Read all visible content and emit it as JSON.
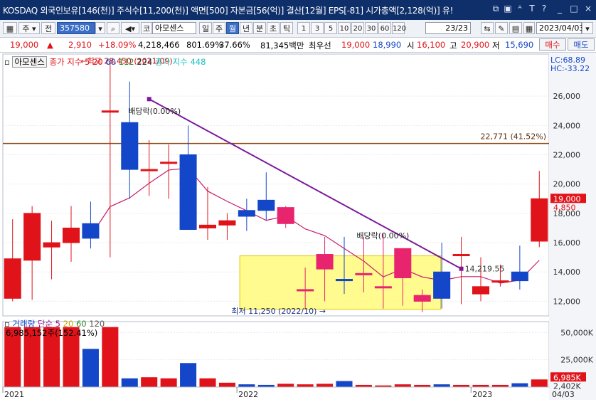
{
  "window": {
    "title": "KOSDAQ 외국인보유[146(천)] 주식수[11,200(천)] 액면[500] 자본금[56(억)] 결산[12월] EPS[-81] 시가총액[2,128(억)] 유!",
    "icons": [
      "restore-icon",
      "window-icon",
      "font-size-icon",
      "text-icon",
      "help-icon",
      "minimize-icon",
      "maximize-icon"
    ]
  },
  "toolbar": {
    "market_label": "주",
    "period_label": "전",
    "code": "357580",
    "stock_prefix": "코",
    "stock_name": "아모센스",
    "periods": [
      "일",
      "주",
      "월",
      "년",
      "분",
      "초",
      "틱"
    ],
    "selected_period": "월",
    "intervals": [
      "1",
      "3",
      "5",
      "10",
      "20",
      "30",
      "60",
      "120"
    ],
    "page": "23/23",
    "date": "2023/04/03"
  },
  "quote": {
    "price": "19,000",
    "change": "2,910",
    "change_pct": "+18.09%",
    "volume": "4,218,466",
    "turnover_pct": "801.69%",
    "ratio": "37.66%",
    "amount": "81,345백만",
    "pref_label": "최우선",
    "ask": "19,000",
    "bid": "18,990",
    "open_label": "시",
    "open": "16,100",
    "high_label": "고",
    "high": "20,900",
    "low_label": "저",
    "low": "15,690",
    "buy_label": "매수",
    "sell_label": "매도"
  },
  "colors": {
    "up": "#e0131a",
    "down": "#1346c8",
    "title_bg": "#0f2f6a",
    "trendline": "#7a1a9a",
    "hline": "#8b4513",
    "box": "#fffa7a"
  },
  "price_panel": {
    "legend_stock": "아모센스",
    "legend_ma": "종가 지수 5",
    "ma_periods": [
      "20",
      "60",
      "112",
      "224"
    ],
    "legend_index": "종가 지수 448",
    "lc": "LC:68.89",
    "hc": "HC:-33.22",
    "price_ticks": [
      "26,000",
      "24,000",
      "22,000",
      "20,000",
      "18,000",
      "16,000",
      "14,000",
      "12,000"
    ],
    "hline_label": "22,771 (41.52%)",
    "max_label": "최고 28,450 (2021/09)",
    "min_label": "최저 11,250 (2022/10)",
    "dividend_label": "배당락(0.00%)",
    "dividend_label_2": "배당락(0.00%)",
    "trend_end_label": "14,219.55",
    "current_price_tag": "19,000",
    "change_tag": "4,850"
  },
  "volume_panel": {
    "legend_vol": "거래량",
    "legend_ma": "단순 5",
    "ma_periods": [
      "20",
      "60",
      "120"
    ],
    "last_volume": "6,985,152주(152.41%)",
    "ticks": [
      "50,000K",
      "25,000K"
    ],
    "current_tag": "6,985K",
    "ma_tag": "2,402K"
  },
  "x_axis": {
    "labels": [
      "2021",
      "2022",
      "2023",
      "04/03"
    ]
  },
  "chart_data": {
    "type": "candlestick",
    "x": [
      "2021/01",
      "2021/02",
      "2021/03",
      "2021/04",
      "2021/05",
      "2021/06",
      "2021/07",
      "2021/08",
      "2021/09",
      "2021/10",
      "2021/11",
      "2021/12",
      "2022/01",
      "2022/02",
      "2022/03",
      "2022/04",
      "2022/05",
      "2022/06",
      "2022/07",
      "2022/08",
      "2022/09",
      "2022/10",
      "2022/11",
      "2022/12",
      "2023/01",
      "2023/02",
      "2023/03",
      "2023/04"
    ],
    "open": [
      12200,
      14800,
      15700,
      16000,
      17300,
      25000,
      24200,
      21000,
      21500,
      22000,
      17000,
      17200,
      18200,
      18900,
      17300,
      12800,
      14200,
      13500,
      13800,
      13000,
      13600,
      12000,
      14000,
      15200,
      12500,
      13300,
      14000,
      16100
    ],
    "close": [
      14900,
      18000,
      16000,
      17000,
      16300,
      25000,
      21000,
      21000,
      21500,
      16900,
      17200,
      17500,
      17800,
      18200,
      18400,
      12800,
      15200,
      13400,
      13900,
      13000,
      15600,
      12400,
      12200,
      15200,
      13000,
      13400,
      13400,
      19000
    ],
    "high": [
      17600,
      18500,
      17500,
      18500,
      18800,
      28450,
      27000,
      23000,
      22700,
      24000,
      19800,
      18000,
      19000,
      20800,
      18500,
      14300,
      16400,
      16400,
      16400,
      16600,
      15600,
      12800,
      16000,
      16400,
      15000,
      14500,
      15800,
      20900
    ],
    "low": [
      12000,
      12100,
      13500,
      14700,
      15600,
      15000,
      19000,
      19200,
      19000,
      19000,
      16200,
      16200,
      16800,
      17500,
      17000,
      11500,
      12000,
      12500,
      12600,
      11500,
      11700,
      11250,
      11500,
      11800,
      12000,
      13000,
      12800,
      15690
    ],
    "volume": [
      55000,
      55000,
      55000,
      55000,
      35000,
      55000,
      8000,
      9000,
      8000,
      22000,
      8000,
      4000,
      2500,
      2000,
      3000,
      2500,
      3000,
      5500,
      2000,
      1500,
      2500,
      2000,
      2500,
      2000,
      2000,
      2000,
      3500,
      6985
    ],
    "volume_unit": "K",
    "ylim": [
      11000,
      28000
    ],
    "trendline": {
      "from": [
        "2021/08",
        25800
      ],
      "to": [
        "2022/12",
        14219.55
      ]
    },
    "hline": 22771
  }
}
